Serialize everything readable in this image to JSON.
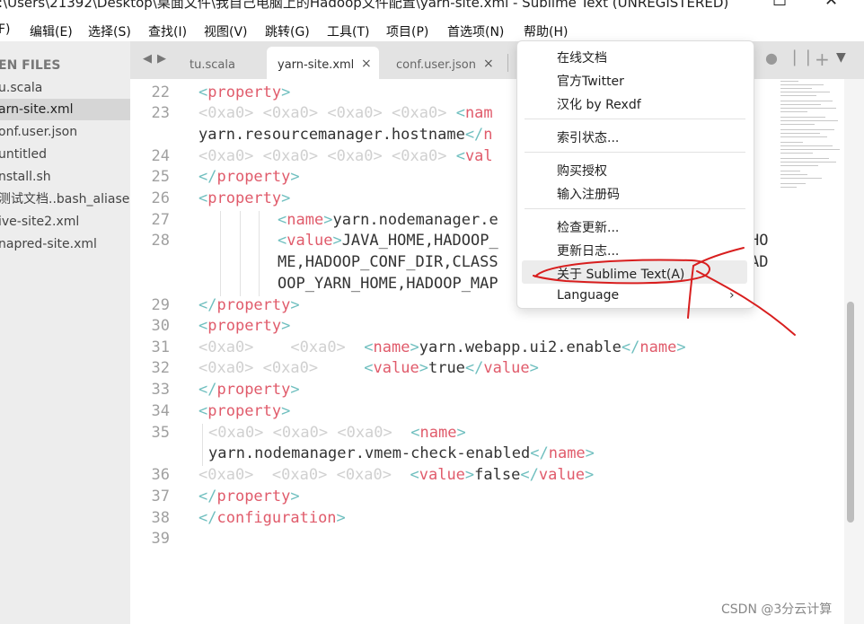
{
  "window": {
    "title": ":\\Users\\21392\\Desktop\\桌面文件\\我自己电脑上的Hadoop文件配置\\yarn-site.xml - Sublime Text (UNREGISTERED)",
    "maximize_icon": "maximize-icon",
    "close_icon": "close-icon"
  },
  "menubar": {
    "items": [
      "F)",
      "编辑(E)",
      "选择(S)",
      "查找(I)",
      "视图(V)",
      "跳转(G)",
      "工具(T)",
      "项目(P)",
      "首选项(N)",
      "帮助(H)"
    ]
  },
  "sidebar": {
    "header": "EN FILES",
    "files": [
      "u.scala",
      "arn-site.xml",
      "onf.user.json",
      "untitled",
      "nstall.sh",
      "测试文档..bash_aliases",
      "ive-site2.xml",
      "napred-site.xml"
    ],
    "active_index": 1
  },
  "tabs": {
    "items": [
      {
        "label": "tu.scala",
        "close": ""
      },
      {
        "label": "yarn-site.xml",
        "close": "×"
      },
      {
        "label": "conf.user.json",
        "close": "×"
      }
    ],
    "active_index": 1,
    "nav_icons": [
      "chevron-left-icon",
      "chevron-right-icon"
    ],
    "right_icons": [
      "dirty-dot-icon",
      "split-icon",
      "plus-icon",
      "chevron-down-icon"
    ]
  },
  "editor": {
    "line_numbers": [
      "22",
      "23",
      "24",
      "25",
      "26",
      "27",
      "28",
      "29",
      "30",
      "31",
      "32",
      "33",
      "34",
      "35",
      "36",
      "37",
      "38",
      "39"
    ],
    "ws": "<0xa0>",
    "line23_wrap": "yarn.resourcemanager.hostname",
    "line27_text": "yarn.nodemanager.e",
    "line28_a": "JAVA_HOME,HADOOP_",
    "line28_a_tail": "HO",
    "line28_b": "ME,HADOOP_CONF_DIR,CLASS",
    "line28_b_tail": "AD",
    "line28_c": "OOP_YARN_HOME,HADOOP_MAP",
    "line31_name": "yarn.webapp.ui2.enable",
    "line32_value": "true",
    "line35_name": "yarn.nodemanager.vmem-check-enabled",
    "line36_value": "false",
    "tags": {
      "property": "property",
      "name": "name",
      "value": "value",
      "configuration": "configuration",
      "name_partial": "nam",
      "name_partial2": "n",
      "value_partial": "val"
    }
  },
  "help_menu": {
    "items": [
      "在线文档",
      "官方Twitter",
      "汉化 by Rexdf",
      "索引状态...",
      "购买授权",
      "输入注册码",
      "检查更新...",
      "更新日志...",
      "关于 Sublime Text(A)",
      "Language"
    ],
    "submenu_arrow": "›",
    "highlighted_index": 8
  },
  "watermark": "CSDN @3分云计算",
  "annotation_color": "#d81e1e"
}
